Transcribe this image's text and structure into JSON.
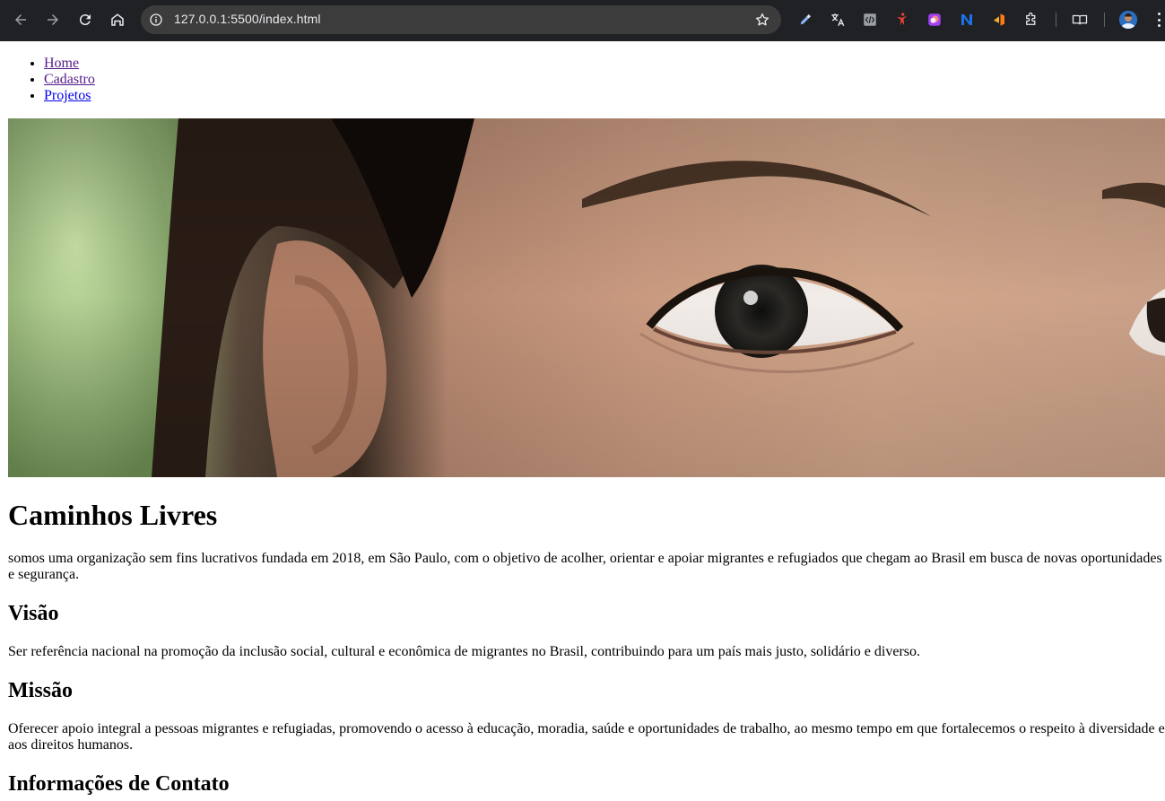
{
  "browser": {
    "url": "127.0.0.1:5500/index.html",
    "icons": [
      "back-icon",
      "forward-icon",
      "reload-icon",
      "home-icon",
      "site-info-icon",
      "bookmark-star-icon",
      "eyedropper-extension-icon",
      "translate-extension-icon",
      "code-extension-icon",
      "dancer-extension-icon",
      "color-extension-icon",
      "n-extension-icon",
      "builder-extension-icon",
      "extensions-puzzle-icon",
      "reading-list-icon",
      "profile-avatar",
      "menu-kebab-icon"
    ]
  },
  "nav": {
    "items": [
      {
        "label": "Home",
        "visited": true
      },
      {
        "label": "Cadastro",
        "visited": true
      },
      {
        "label": "Projetos",
        "visited": false
      }
    ]
  },
  "hero": {
    "icon": "hero-photo-face-closeup"
  },
  "content": {
    "title": "Caminhos Livres",
    "intro": "somos uma organização sem fins lucrativos fundada em 2018, em São Paulo, com o objetivo de acolher, orientar e apoiar migrantes e refugiados que chegam ao Brasil em busca de novas oportunidades e segurança.",
    "vision_heading": "Visão",
    "vision_text": "Ser referência nacional na promoção da inclusão social, cultural e econômica de migrantes no Brasil, contribuindo para um país mais justo, solidário e diverso.",
    "mission_heading": "Missão",
    "mission_text": "Oferecer apoio integral a pessoas migrantes e refugiadas, promovendo o acesso à educação, moradia, saúde e oportunidades de trabalho, ao mesmo tempo em que fortalecemos o respeito à diversidade e aos direitos humanos.",
    "contact_heading": "Informações de Contato"
  },
  "colors": {
    "chrome_bg": "#202124",
    "omnibox_bg": "#3c3c3c",
    "visited_link": "#551a8b",
    "link": "#0000ee"
  }
}
